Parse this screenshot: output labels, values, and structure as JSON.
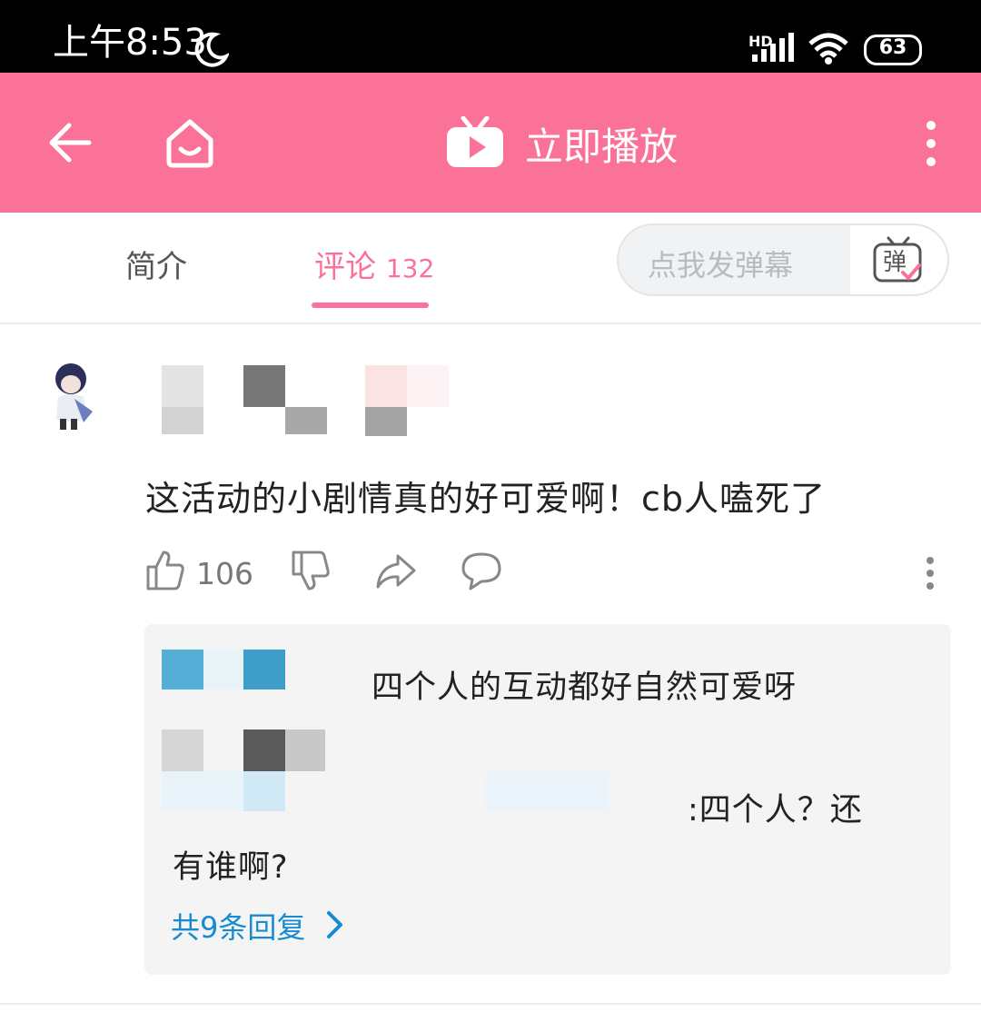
{
  "status_bar": {
    "time": "上午8:53",
    "battery": "63",
    "network": "HD"
  },
  "header": {
    "title": "立即播放",
    "back_icon": "arrow-left-icon",
    "home_icon": "home-icon",
    "tv_icon": "tv-play-icon",
    "more_icon": "more-vertical-icon"
  },
  "tabs": {
    "intro_label": "简介",
    "comment_label": "评论",
    "comment_count": "132"
  },
  "danmaku": {
    "placeholder": "点我发弹幕",
    "button_glyph": "弹"
  },
  "comment": {
    "text": "这活动的小剧情真的好可爱啊！cb人嗑死了",
    "like_count": "106"
  },
  "replies": {
    "reply1_text": "四个人的互动都好自然可爱呀",
    "reply2_text_a": ":四个人？还",
    "reply2_text_b": "有谁啊?",
    "more_label": "共9条回复"
  },
  "colors": {
    "brand_pink": "#fb7299",
    "link_blue": "#178bcf"
  }
}
